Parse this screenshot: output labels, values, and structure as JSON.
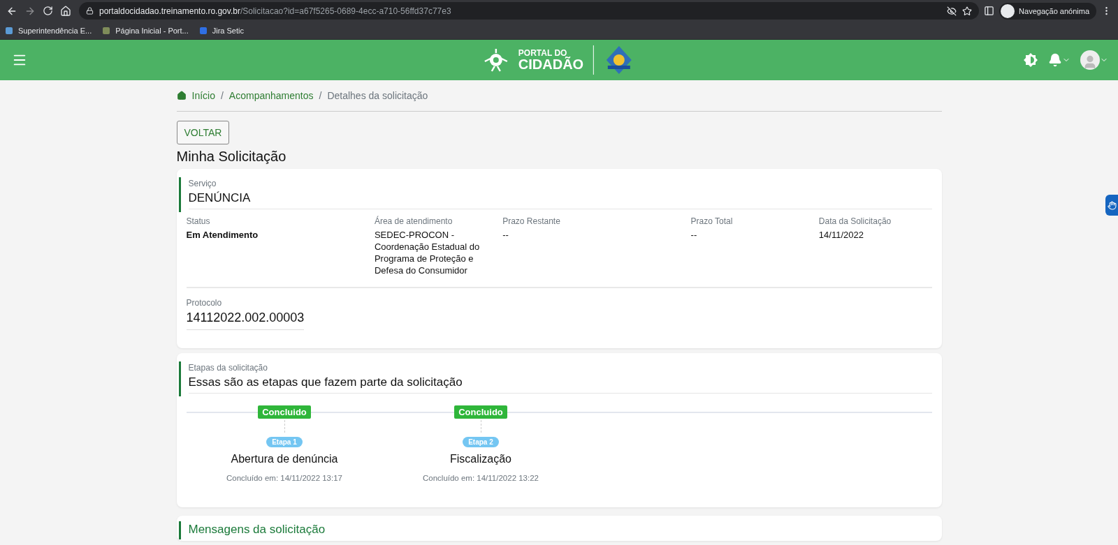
{
  "browser": {
    "url_host": "portaldocidadao.treinamento.ro.gov.br",
    "url_path": "/Solicitacao?id=a67f5265-0689-4ecc-a710-56ffd37c77e3",
    "profile_label": "Navegação anónima",
    "bookmarks": [
      {
        "label": "Superintendência E..."
      },
      {
        "label": "Página Inicial - Port..."
      },
      {
        "label": "Jira Setic"
      }
    ]
  },
  "header": {
    "logo_line_1": "PORTAL DO",
    "logo_line_2": "CIDADÃO"
  },
  "breadcrumb_separator": "/",
  "breadcrumb": [
    {
      "label": "Início",
      "current": false
    },
    {
      "label": "Acompanhamentos",
      "current": false
    },
    {
      "label": "Detalhes da solicitação",
      "current": true
    }
  ],
  "back_button": "VOLTAR",
  "page_title": "Minha Solicitação",
  "service_card": {
    "label": "Serviço",
    "value": "DENÚNCIA",
    "fields": [
      {
        "label": "Status",
        "value": "Em Atendimento",
        "emphasized": true
      },
      {
        "label": "Área de atendimento",
        "value": "SEDEC-PROCON - Coordenação Estadual do Programa de Proteção e Defesa do Consumidor",
        "emphasized": false
      },
      {
        "label": "Prazo Restante",
        "value": "--",
        "emphasized": false
      },
      {
        "label": "Prazo Total",
        "value": "--",
        "emphasized": false
      },
      {
        "label": "Data da Solicitação",
        "value": "14/11/2022",
        "emphasized": false
      }
    ],
    "protocol": {
      "label": "Protocolo",
      "value": "14112022.002.00003"
    }
  },
  "steps_card": {
    "label": "Etapas da solicitação",
    "title": "Essas são as etapas que fazem parte da solicitação",
    "steps": [
      {
        "status": "Concluido",
        "completed": true,
        "step": "Etapa 1",
        "name": "Abertura de denúncia",
        "completed_at": "Concluído em: 14/11/2022 13:17"
      },
      {
        "status": "Concluido",
        "completed": true,
        "step": "Etapa 2",
        "name": "Fiscalização",
        "completed_at": "Concluído em: 14/11/2022 13:22"
      }
    ]
  },
  "messages_card": {
    "title": "Mensagens da solicitação"
  }
}
